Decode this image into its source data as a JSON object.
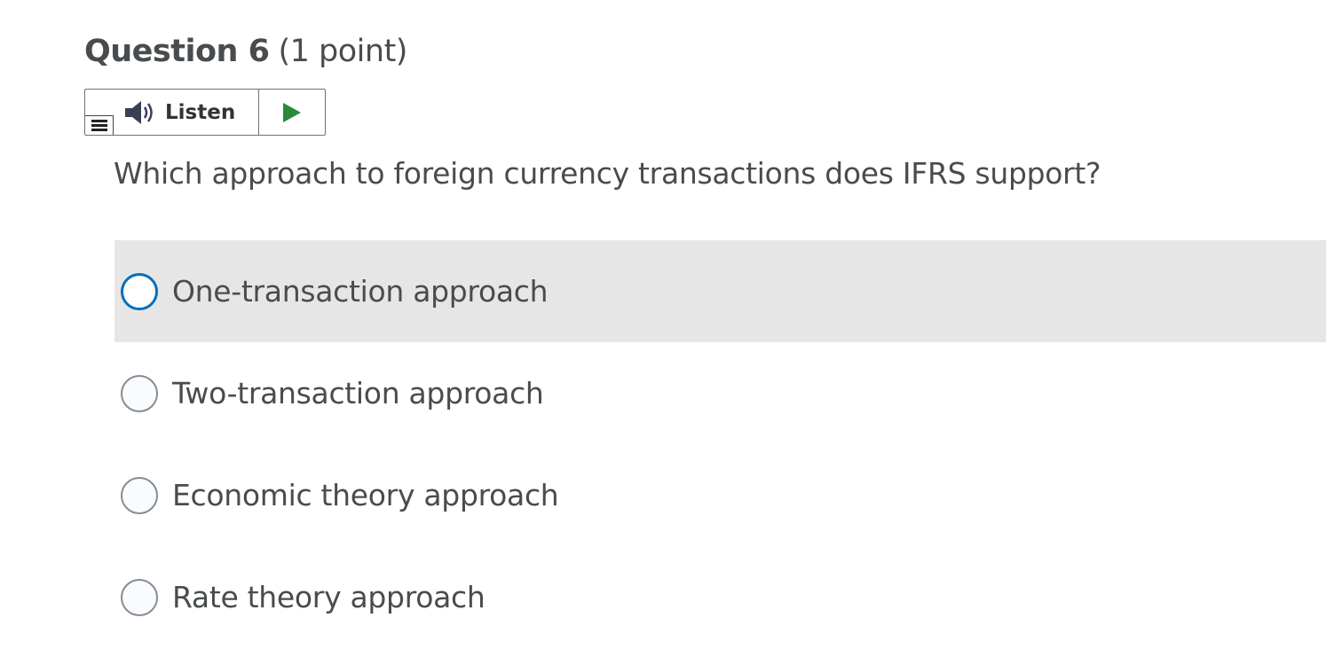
{
  "question": {
    "title": "Question 6",
    "points": "(1 point)",
    "text": "Which approach to foreign currency transactions does IFRS support?"
  },
  "listen": {
    "label": "Listen",
    "icons": {
      "speaker": "speaker-icon",
      "play": "play-icon",
      "menu": "menu-icon"
    },
    "colors": {
      "play": "#2a8a3a",
      "speaker": "#3a3f58"
    }
  },
  "options": [
    {
      "label": "One-transaction approach",
      "hovered": true
    },
    {
      "label": "Two-transaction approach",
      "hovered": false
    },
    {
      "label": "Economic theory approach",
      "hovered": false
    },
    {
      "label": "Rate theory approach",
      "hovered": false
    }
  ],
  "colors": {
    "text": "#494c4e",
    "hover_background": "#e6e6e6",
    "radio_focus_border": "#006fbf"
  }
}
